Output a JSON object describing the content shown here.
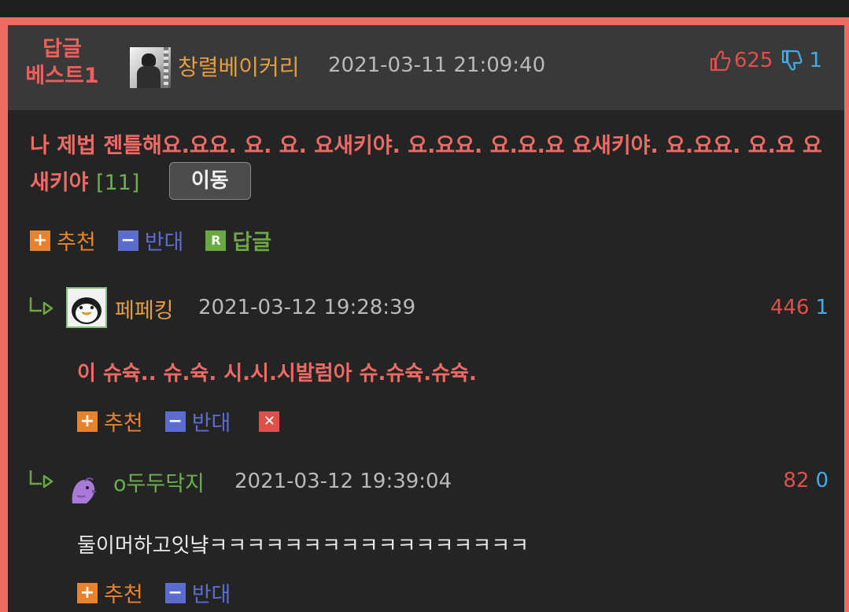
{
  "best_post": {
    "badge_line1": "답글",
    "badge_line2": "베스트1",
    "author": "창렬베이커리",
    "date": "2021-03-11 21:09:40",
    "upvotes": "625",
    "downvotes": "1",
    "content": "나 제법 젠틀해요.요요. 요. 요. 요새키야. 요.요요. 요.요.요 요새키야. 요.요요. 요.요 요새키야",
    "reply_count": "[11]",
    "move_button": "이동",
    "actions": {
      "recommend": "추천",
      "oppose": "반대",
      "reply": "답글"
    }
  },
  "comments": [
    {
      "author": "페페킹",
      "date": "2021-03-12 19:28:39",
      "upvotes": "446",
      "downvotes": "1",
      "text": "이 슈슉.. 슈.슉. 시.시.시발럼아 슈.슈슉.슈슉.",
      "actions": {
        "recommend": "추천",
        "oppose": "반대"
      },
      "avatar_icon": "penguin-avatar"
    },
    {
      "author": "o두두닥지",
      "date": "2021-03-12 19:39:04",
      "upvotes": "82",
      "downvotes": "0",
      "text": "둘이머하고잇냨ㅋㅋㅋㅋㅋㅋㅋㅋㅋㅋㅋㅋㅋㅋㅋㅋㅋ",
      "actions": {
        "recommend": "추천",
        "oppose": "반대"
      },
      "avatar_icon": "purple-bird-avatar"
    }
  ],
  "colors": {
    "frame": "#ee6a64",
    "panel": "#242424",
    "header": "#393939",
    "author_orange": "#e59d42",
    "author_green": "#6ab04c",
    "upvote_red": "#e0504b",
    "downvote_blue": "#46a9e8",
    "recommend_orange": "#e5832e",
    "oppose_blue": "#5c6bd0",
    "reply_green": "#6aa842"
  }
}
